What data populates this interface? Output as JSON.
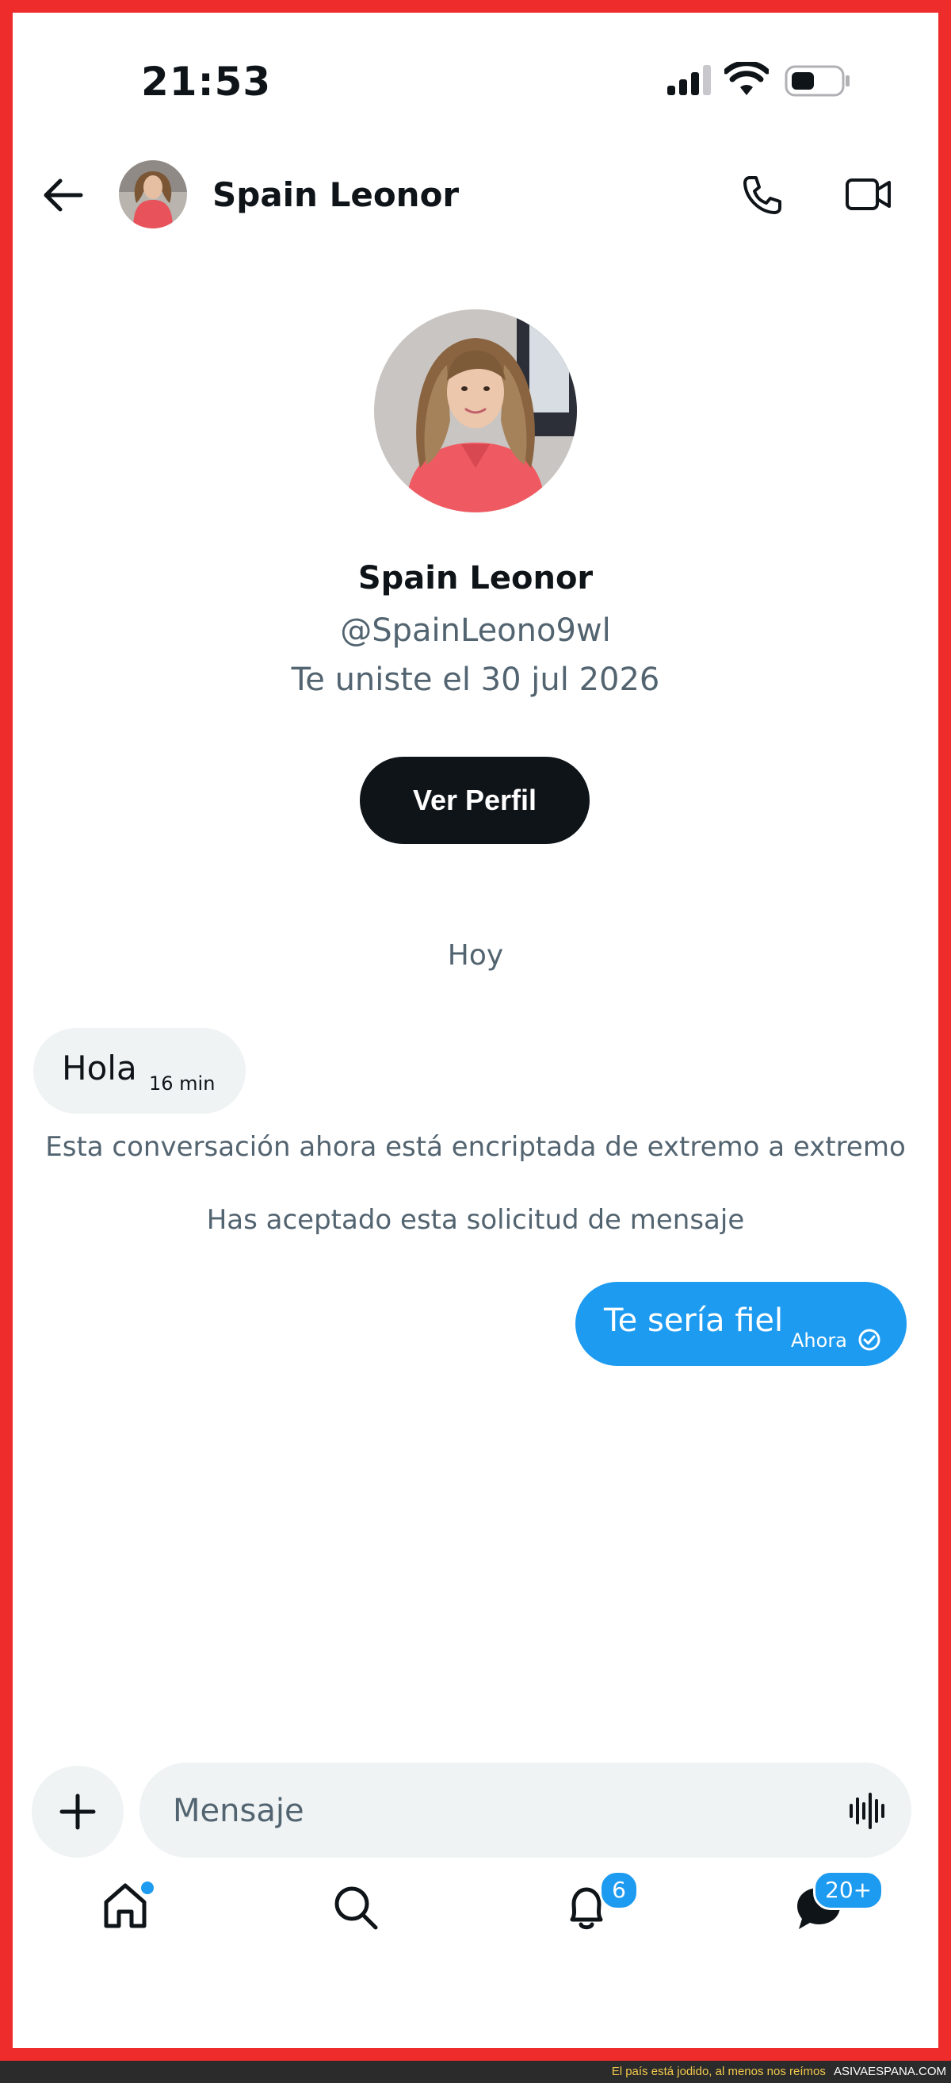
{
  "status_bar": {
    "time": "21:53"
  },
  "header": {
    "contact_name": "Spain Leonor"
  },
  "profile": {
    "name": "Spain Leonor",
    "handle": "@SpainLeono9wl",
    "joined": "Te uniste el 30 jul 2026",
    "view_profile_label": "Ver Perfil"
  },
  "conversation": {
    "date_separator": "Hoy",
    "messages": [
      {
        "direction": "incoming",
        "text": "Hola",
        "time": "16 min"
      },
      {
        "direction": "outgoing",
        "text": "Te sería fiel",
        "time": "Ahora",
        "status_icon": "sent-check-icon"
      }
    ],
    "system_notes": [
      "Esta conversación ahora está encriptada de extremo a extremo",
      "Has aceptado esta solicitud de mensaje"
    ]
  },
  "composer": {
    "placeholder": "Mensaje"
  },
  "bottom_nav": {
    "items": [
      {
        "name": "home",
        "icon": "home-icon",
        "has_dot": true
      },
      {
        "name": "search",
        "icon": "search-icon"
      },
      {
        "name": "notifications",
        "icon": "bell-icon",
        "badge": "6"
      },
      {
        "name": "messages",
        "icon": "messages-icon",
        "badge": "20+"
      }
    ]
  },
  "watermark": {
    "caption": "El país está jodido, al menos nos reímos",
    "site": "ASIVAESPANA.COM"
  },
  "colors": {
    "accent": "#1d9bf0",
    "frame": "#ee2c2c",
    "text_primary": "#0f1419",
    "text_secondary": "#536471",
    "bubble_incoming": "#eff3f4"
  }
}
